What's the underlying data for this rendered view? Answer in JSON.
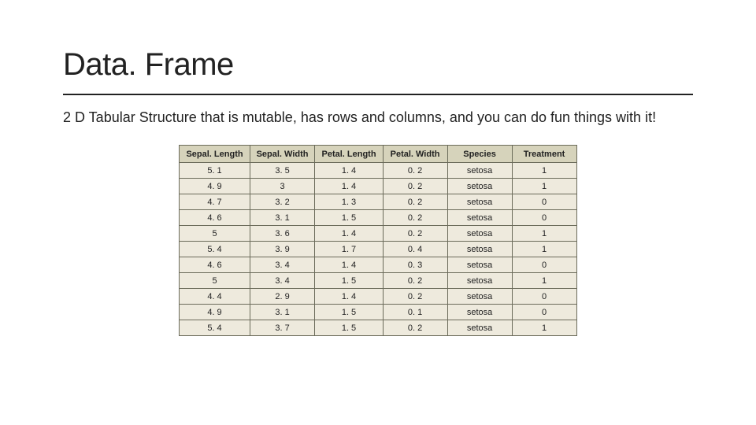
{
  "title": "Data. Frame",
  "subtitle": "2 D Tabular Structure that is mutable, has rows and columns, and you can do fun things with it!",
  "table": {
    "columns": [
      "Sepal. Length",
      "Sepal. Width",
      "Petal. Length",
      "Petal. Width",
      "Species",
      "Treatment"
    ],
    "rows": [
      [
        "5. 1",
        "3. 5",
        "1. 4",
        "0. 2",
        "setosa",
        "1"
      ],
      [
        "4. 9",
        "3",
        "1. 4",
        "0. 2",
        "setosa",
        "1"
      ],
      [
        "4. 7",
        "3. 2",
        "1. 3",
        "0. 2",
        "setosa",
        "0"
      ],
      [
        "4. 6",
        "3. 1",
        "1. 5",
        "0. 2",
        "setosa",
        "0"
      ],
      [
        "5",
        "3. 6",
        "1. 4",
        "0. 2",
        "setosa",
        "1"
      ],
      [
        "5. 4",
        "3. 9",
        "1. 7",
        "0. 4",
        "setosa",
        "1"
      ],
      [
        "4. 6",
        "3. 4",
        "1. 4",
        "0. 3",
        "setosa",
        "0"
      ],
      [
        "5",
        "3. 4",
        "1. 5",
        "0. 2",
        "setosa",
        "1"
      ],
      [
        "4. 4",
        "2. 9",
        "1. 4",
        "0. 2",
        "setosa",
        "0"
      ],
      [
        "4. 9",
        "3. 1",
        "1. 5",
        "0. 1",
        "setosa",
        "0"
      ],
      [
        "5. 4",
        "3. 7",
        "1. 5",
        "0. 2",
        "setosa",
        "1"
      ]
    ]
  }
}
